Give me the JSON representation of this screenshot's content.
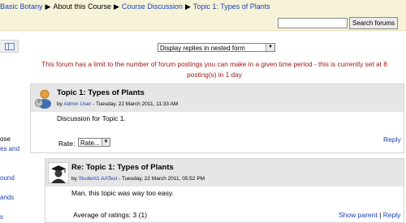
{
  "breadcrumb": {
    "items": [
      "Basic Botany",
      "About this Course",
      "Course Discussion",
      "Topic 1: Types of Plants"
    ],
    "separator": "▶"
  },
  "search": {
    "button_label": "Search forums",
    "value": ""
  },
  "left_block": {
    "lines": [
      "ose",
      "es and",
      "ound",
      "ands",
      "s"
    ]
  },
  "display_mode": {
    "selected": "Display replies in nested form"
  },
  "notice": "This forum has a limit to the number of forum postings you can make in a given time period - this is currently set at 8 posting(s) in 1 day",
  "posts": [
    {
      "subject": "Topic 1: Types of Plants",
      "by_prefix": "by",
      "author": "Admin User",
      "date": " - Tuesday, 22 March 2011, 11:33 AM",
      "body": "Discussion for Topic 1.",
      "rate_label": "Rate:",
      "rate_select": "Rate...",
      "reply": "Reply"
    },
    {
      "subject": "Re: Topic 1: Types of Plants",
      "by_prefix": "by",
      "author": "Student1 AATest",
      "date": " - Tuesday, 22 March 2011, 05:52 PM",
      "body": "Man, this topic was way too easy.",
      "ratings": "Average of ratings: 3 (1)",
      "show_parent": "Show parent",
      "separator": "|",
      "reply": "Reply"
    }
  ],
  "colors": {
    "navbar": "#f7f3d8",
    "link": "#1a3fb3",
    "notice": "#a01818",
    "post_header": "#e6e6e6"
  }
}
